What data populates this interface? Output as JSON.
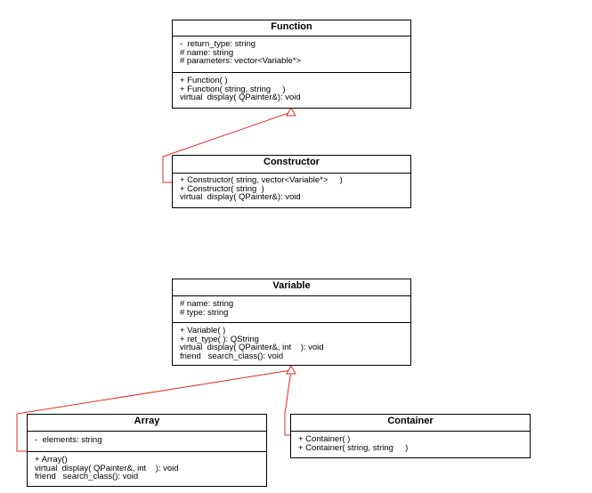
{
  "classes": {
    "function": {
      "name": "Function",
      "attributes": [
        "-  return_type: string",
        "# name: string",
        "# parameters: vector<Variable*>"
      ],
      "methods": [
        "+ Function( )",
        "+ Function( string, string     )",
        "virtual  display( QPainter&): void"
      ]
    },
    "constructor": {
      "name": "Constructor",
      "attributes": [],
      "methods": [
        "+ Constructor( string, vector<Variable*>     )",
        "+ Constructor( string  )",
        "virtual  display( QPainter&): void"
      ]
    },
    "variable": {
      "name": "Variable",
      "attributes": [
        "# name: string",
        "# type: string"
      ],
      "methods": [
        "+ Variable( )",
        "+ ret_type( ): QString",
        "virtual  display( QPainter&, int    ): void",
        "friend   search_class(): void"
      ]
    },
    "array": {
      "name": "Array",
      "attributes": [
        "-  elements: string"
      ],
      "methods": [
        "+ Array()",
        "virtual  display( QPainter&, int    ): void",
        "friend   search_class(): void"
      ]
    },
    "container": {
      "name": "Container",
      "attributes": [],
      "methods": [
        "+ Container( )",
        "+ Container( string, string     )"
      ]
    }
  },
  "colors": {
    "inheritance_line": "#e8281f",
    "border": "#000000"
  }
}
